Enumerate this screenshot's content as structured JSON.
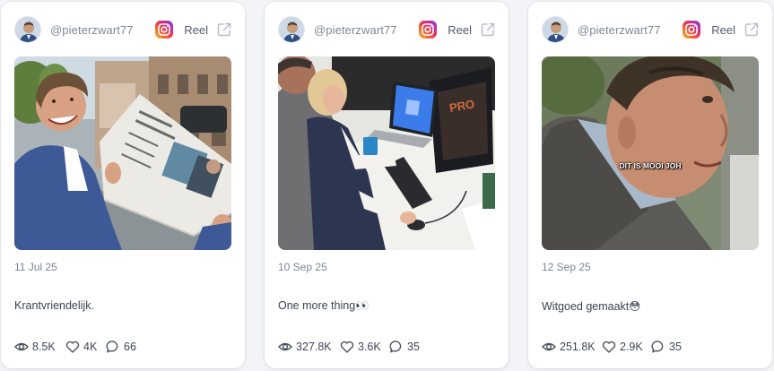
{
  "cards": [
    {
      "username": "@pieterzwart77",
      "platform_icon": "instagram-icon",
      "type_label": "Reel",
      "date": "11 Jul 25",
      "text": "Krantvriendelijk.",
      "views": "8.5K",
      "likes": "4K",
      "comments": "66"
    },
    {
      "username": "@pieterzwart77",
      "platform_icon": "instagram-icon",
      "type_label": "Reel",
      "date": "10 Sep 25",
      "text": "One more thing👀",
      "views": "327.8K",
      "likes": "3.6K",
      "comments": "35"
    },
    {
      "username": "@pieterzwart77",
      "platform_icon": "instagram-icon",
      "type_label": "Reel",
      "date": "12 Sep 25",
      "text": "Witgoed gemaakt😳",
      "views": "251.8K",
      "likes": "2.9K",
      "comments": "35",
      "video_caption": "DIT IS MOOI JOH"
    }
  ],
  "colors": {
    "text_muted": "#7f8793",
    "text_main": "#3b4250",
    "card_bg": "#ffffff",
    "page_bg": "#f3f4f7"
  }
}
